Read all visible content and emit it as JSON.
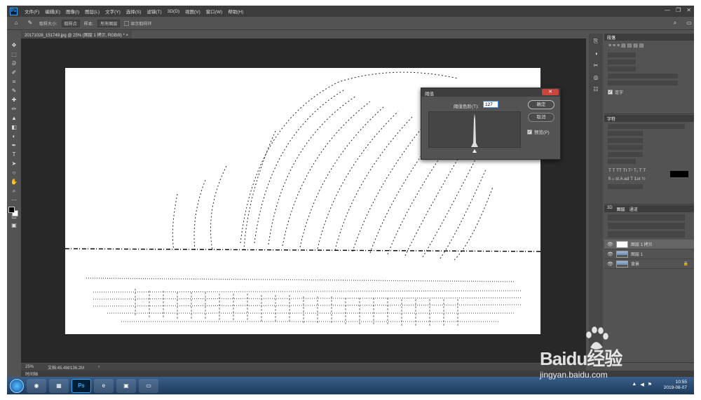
{
  "menubar": {
    "items": [
      "文件(F)",
      "编辑(E)",
      "图像(I)",
      "图层(L)",
      "文字(Y)",
      "选择(S)",
      "滤镜(T)",
      "3D(D)",
      "视图(V)",
      "窗口(W)",
      "帮助(H)"
    ]
  },
  "options": {
    "sample_size_label": "取样大小:",
    "sample_size_value": "取样点",
    "sample_label": "样本:",
    "sample_value": "所有图层",
    "show_ring_label": "显示取样环"
  },
  "document": {
    "tab_title": "20171028_151749.jpg @ 25% (图层 1 拷贝, RGB/8) * ×"
  },
  "status": {
    "zoom": "25%",
    "doc_size": "文档:45.4M/136.2M",
    "timeline": "时间轴"
  },
  "dialog": {
    "title": "阈值",
    "threshold_label": "阈值色阶(T):",
    "threshold_value": "127",
    "ok_label": "确定",
    "cancel_label": "取消",
    "preview_label": "预览(P)",
    "preview_checked": true
  },
  "panels": {
    "paragraph_tab": "段落",
    "character_tab": "字符",
    "hyphenate_label": "连字",
    "layers_tabs": [
      "3D",
      "图层",
      "通道"
    ],
    "layers": [
      {
        "name": "图层 1 拷贝",
        "thumb": "white",
        "selected": true
      },
      {
        "name": "图层 1",
        "thumb": "photo",
        "selected": false
      },
      {
        "name": "背景",
        "thumb": "photo",
        "selected": false,
        "locked": true
      }
    ]
  },
  "taskbar": {
    "time": "10:55",
    "date": "2019-08-07"
  },
  "watermark": {
    "brand": "Baidu经验",
    "url": "jingyan.baidu.com"
  },
  "colors": {
    "app_bg": "#535353",
    "canvas_bg": "#282828",
    "accent": "#31a8ff"
  }
}
